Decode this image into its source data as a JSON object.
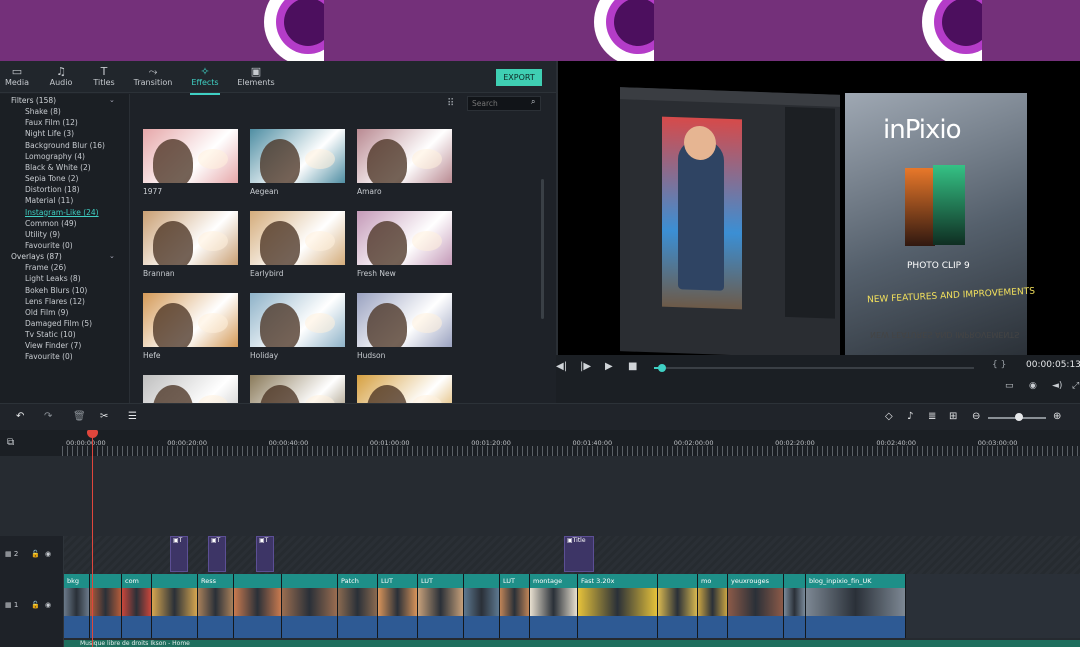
{
  "banner": {
    "logo_icon": "circle-logo-icon"
  },
  "tabs": [
    {
      "label": "Media",
      "icon": "folder-icon",
      "glyph": "▭"
    },
    {
      "label": "Audio",
      "icon": "music-note-icon",
      "glyph": "♫"
    },
    {
      "label": "Titles",
      "icon": "text-icon",
      "glyph": "T"
    },
    {
      "label": "Transition",
      "icon": "transition-icon",
      "glyph": "⤳"
    },
    {
      "label": "Effects",
      "icon": "effects-icon",
      "glyph": "✧",
      "active": true
    },
    {
      "label": "Elements",
      "icon": "image-icon",
      "glyph": "▣"
    }
  ],
  "export_label": "EXPORT",
  "search": {
    "placeholder": "Search"
  },
  "categories": {
    "filters_label": "Filters (158)",
    "filters": [
      "Shake (8)",
      "Faux Film (12)",
      "Night Life (3)",
      "Background Blur (16)",
      "Lomography (4)",
      "Black & White (2)",
      "Sepia Tone (2)",
      "Distortion (18)",
      "Material (11)",
      "Instagram-Like (24)",
      "Common (49)",
      "Utility (9)",
      "Favourite (0)"
    ],
    "active_filter": "Instagram-Like (24)",
    "overlays_label": "Overlays (87)",
    "overlays": [
      "Frame (26)",
      "Light Leaks (8)",
      "Bokeh Blurs (10)",
      "Lens Flares (12)",
      "Old Film (9)",
      "Damaged Film (5)",
      "Tv Static (10)",
      "View Finder (7)",
      "Favourite (0)"
    ]
  },
  "effects": [
    {
      "label": "1977",
      "tint": "#e6a7a9"
    },
    {
      "label": "Aegean",
      "tint": "#4f8ea3"
    },
    {
      "label": "Amaro",
      "tint": "#b98a92"
    },
    {
      "label": "Brannan",
      "tint": "#c99f73"
    },
    {
      "label": "Earlybird",
      "tint": "#d4ac7b"
    },
    {
      "label": "Fresh New",
      "tint": "#c49ab8"
    },
    {
      "label": "Hefe",
      "tint": "#d49a58"
    },
    {
      "label": "Holiday",
      "tint": "#8eb2c8"
    },
    {
      "label": "Hudson",
      "tint": "#9aa2c0"
    },
    {
      "label": "",
      "tint": "#bfbfbf"
    },
    {
      "label": "",
      "tint": "#8a7a5a"
    },
    {
      "label": "",
      "tint": "#d6a040"
    }
  ],
  "preview": {
    "brand": "inPixio",
    "product": "PHOTO CLIP 9",
    "tagline": "NEW FEATURES AND IMPROVEMENTS",
    "timecode": "00:00:05:13",
    "progress": 0.02
  },
  "timeline": {
    "ticks": [
      "00:00:00:00",
      "00:00:20:00",
      "00:00:40:00",
      "00:01:00:00",
      "00:01:20:00",
      "00:01:40:00",
      "00:02:00:00",
      "00:02:20:00",
      "00:02:40:00",
      "00:03:00:00"
    ],
    "track2_label": "2",
    "track1_label": "1",
    "title_clips": [
      "T",
      "T",
      "T",
      "Title"
    ],
    "clips": [
      {
        "label": "bkg",
        "color": "#6b7a8a"
      },
      {
        "label": "",
        "color": "#b35c3a"
      },
      {
        "label": "com",
        "color": "#c9463b"
      },
      {
        "label": "",
        "color": "#d6a650"
      },
      {
        "label": "Ress",
        "color": "#a8805a"
      },
      {
        "label": "",
        "color": "#c97a4f"
      },
      {
        "label": "",
        "color": "#9a6d50"
      },
      {
        "label": "Patch",
        "color": "#8a6a50"
      },
      {
        "label": "LUT",
        "color": "#d8945a"
      },
      {
        "label": "LUT",
        "color": "#c6a07a"
      },
      {
        "label": "",
        "color": "#5d7890"
      },
      {
        "label": "LUT",
        "color": "#bf8457"
      },
      {
        "label": "montage",
        "color": "#e8e0d0"
      },
      {
        "label": "Fast 3.20x",
        "color": "#e6c23a"
      },
      {
        "label": "",
        "color": "#d8b850"
      },
      {
        "label": "mo",
        "color": "#c9a443"
      },
      {
        "label": "yeuxrouges",
        "color": "#8c5a48"
      },
      {
        "label": "",
        "color": "#7a8a9a"
      },
      {
        "label": "blog_inpixio_fin_UK",
        "color": "#7d8894"
      }
    ],
    "audio_label": "Musique libre de droits Ikson - Home"
  }
}
